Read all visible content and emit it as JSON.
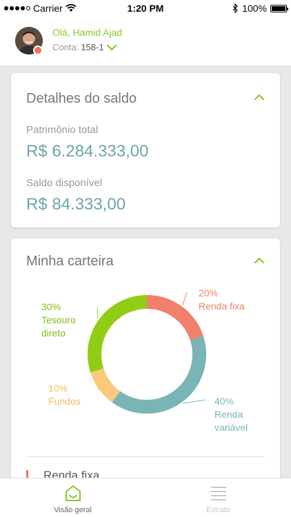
{
  "status_bar": {
    "carrier": "Carrier",
    "time": "1:20 PM",
    "battery": "100%"
  },
  "header": {
    "greeting": "Olá, Hamid Ajad",
    "account_label": "Conta:",
    "account_number": "158-1"
  },
  "balance_card": {
    "title": "Detalhes do saldo",
    "total_label": "Patrimônio total",
    "total_value": "R$ 6.284.333,00",
    "available_label": "Saldo disponível",
    "available_value": "R$ 84.333,00"
  },
  "portfolio_card": {
    "title": "Minha carteira",
    "first_item": "Renda fixa"
  },
  "chart_data": {
    "type": "pie",
    "categories": [
      "Renda fixa",
      "Renda variável",
      "Fundos",
      "Tesouro direto"
    ],
    "values": [
      20,
      40,
      10,
      30
    ],
    "percent_labels": [
      "20%",
      "40%",
      "10%",
      "30%"
    ],
    "label_lines": [
      [
        "Renda fixa"
      ],
      [
        "Renda",
        "variável"
      ],
      [
        "Fundos"
      ],
      [
        "Tesouro",
        "direto"
      ]
    ],
    "colors": [
      "#f0806b",
      "#7ab5b5",
      "#fbc97b",
      "#91cd14"
    ]
  },
  "tabs": [
    {
      "label": "Visão geral",
      "active": true,
      "icon": "home-icon"
    },
    {
      "label": "Extrato",
      "active": false,
      "icon": "list-icon"
    }
  ],
  "colors": {
    "accent": "#8ac926",
    "value": "#6ea5a8",
    "inactive": "#c8c8c8"
  }
}
